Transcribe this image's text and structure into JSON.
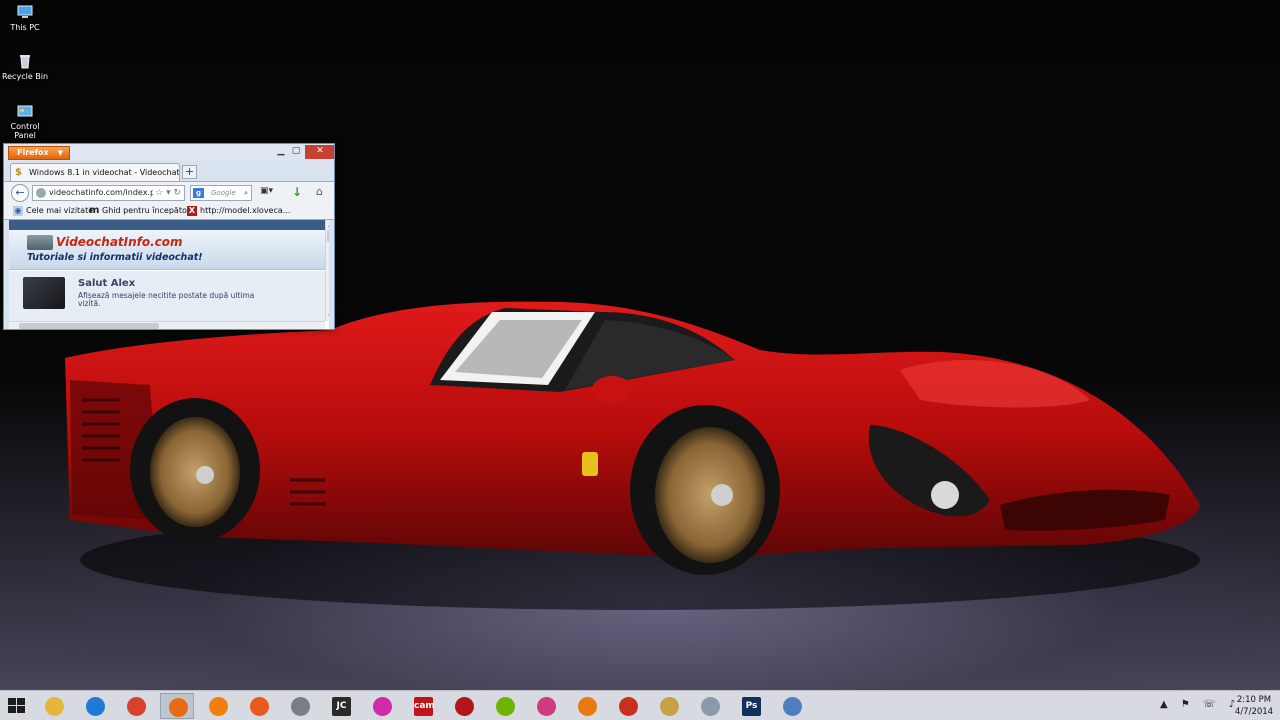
{
  "desktop_icons": [
    {
      "label": "This PC",
      "icon": "computer-icon"
    },
    {
      "label": "Recycle Bin",
      "icon": "recycle-bin-icon"
    },
    {
      "label": "Control Panel",
      "icon": "control-panel-icon"
    }
  ],
  "firefox": {
    "menu_label": "Firefox",
    "tab_title": "Windows 8.1 in videochat - Videochat in...",
    "new_tab": "+",
    "url": "videochatinfo.com/index.p",
    "search_placeholder": "Google",
    "bookmarks": [
      {
        "label": "Cele mai vizitate"
      },
      {
        "label": "Ghid pentru începători"
      },
      {
        "label": "http://model.xloveca..."
      }
    ],
    "page": {
      "site_name": "VideochatInfo.com",
      "tagline": "Tutoriale si informatii videochat!",
      "greeting": "Salut Alex",
      "unread_msg": "Afișează mesajele necitite postate după ultima vizită."
    }
  },
  "taskbar": {
    "apps": [
      {
        "name": "file-explorer",
        "color": "#e7b53c"
      },
      {
        "name": "internet-explorer",
        "color": "#1f7ad6"
      },
      {
        "name": "chrome",
        "color": "#d8402f"
      },
      {
        "name": "firefox",
        "color": "#e66b16",
        "active": true
      },
      {
        "name": "vlc",
        "color": "#f07f10"
      },
      {
        "name": "app-camera-orange",
        "color": "#ea5a1c"
      },
      {
        "name": "webcam",
        "color": "#777e86"
      },
      {
        "name": "jc-app",
        "color": "#2a2a2a",
        "label": "JC"
      },
      {
        "name": "app-pink",
        "color": "#d02aa8"
      },
      {
        "name": "super-cam",
        "color": "#c0151a",
        "label": "cam"
      },
      {
        "name": "app-red-disk",
        "color": "#b3151a"
      },
      {
        "name": "yahoo-messenger",
        "color": "#6fb400"
      },
      {
        "name": "app-colorful",
        "color": "#d03a7e"
      },
      {
        "name": "app-globe-orange",
        "color": "#e87a12"
      },
      {
        "name": "ccleaner",
        "color": "#c8301e"
      },
      {
        "name": "app-ball",
        "color": "#c7a04a"
      },
      {
        "name": "app-monitor",
        "color": "#8a9aaa"
      },
      {
        "name": "photoshop",
        "color": "#11305c",
        "label": "Ps"
      },
      {
        "name": "calculator",
        "color": "#4d7fc1"
      }
    ],
    "tray_icons": "▲ ⚑ ☏ ♪",
    "clock_time": "2:10 PM",
    "clock_date": "4/7/2014"
  }
}
